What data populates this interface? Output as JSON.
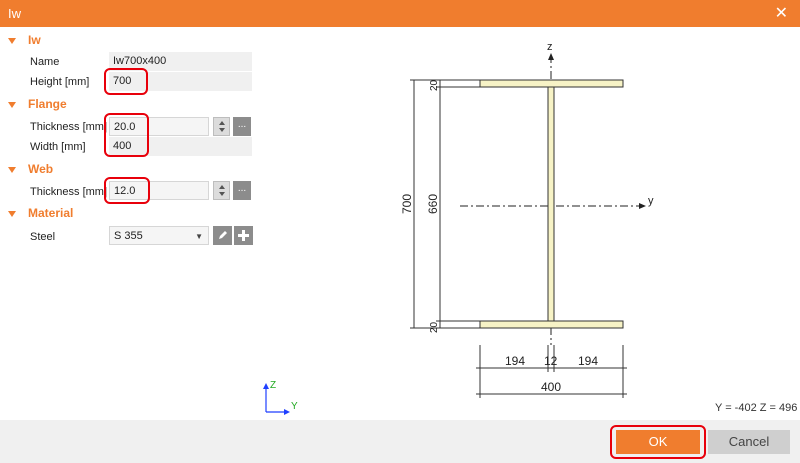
{
  "window": {
    "title": "Iw",
    "close_glyph": "✕"
  },
  "sections": {
    "iw": {
      "title": "Iw",
      "name_label": "Name",
      "name_value": "Iw700x400",
      "height_label": "Height [mm]",
      "height_value": "700"
    },
    "flange": {
      "title": "Flange",
      "thickness_label": "Thickness [mm]",
      "thickness_value": "20.0",
      "width_label": "Width [mm]",
      "width_value": "400"
    },
    "web": {
      "title": "Web",
      "thickness_label": "Thickness [mm]",
      "thickness_value": "12.0"
    },
    "material": {
      "title": "Material",
      "steel_label": "Steel",
      "steel_value": "S 355"
    }
  },
  "drawing": {
    "axis_z": "z",
    "axis_y": "y",
    "dim_total_height": "700",
    "dim_web_height": "660",
    "dim_flange_top": "20",
    "dim_flange_bottom": "20",
    "dim_left": "194",
    "dim_web": "12",
    "dim_right": "194",
    "dim_width": "400",
    "mini_axis_z": "Z",
    "mini_axis_y": "Y"
  },
  "status": {
    "coords": "Y = -402  Z = 496"
  },
  "buttons": {
    "ok": "OK",
    "cancel": "Cancel",
    "more": "...",
    "edit_icon": "pencil-icon",
    "add_icon": "plus-icon"
  },
  "colors": {
    "accent": "#f07d2e",
    "highlight": "#e8000b",
    "section_fill": "#f7f3c6"
  }
}
